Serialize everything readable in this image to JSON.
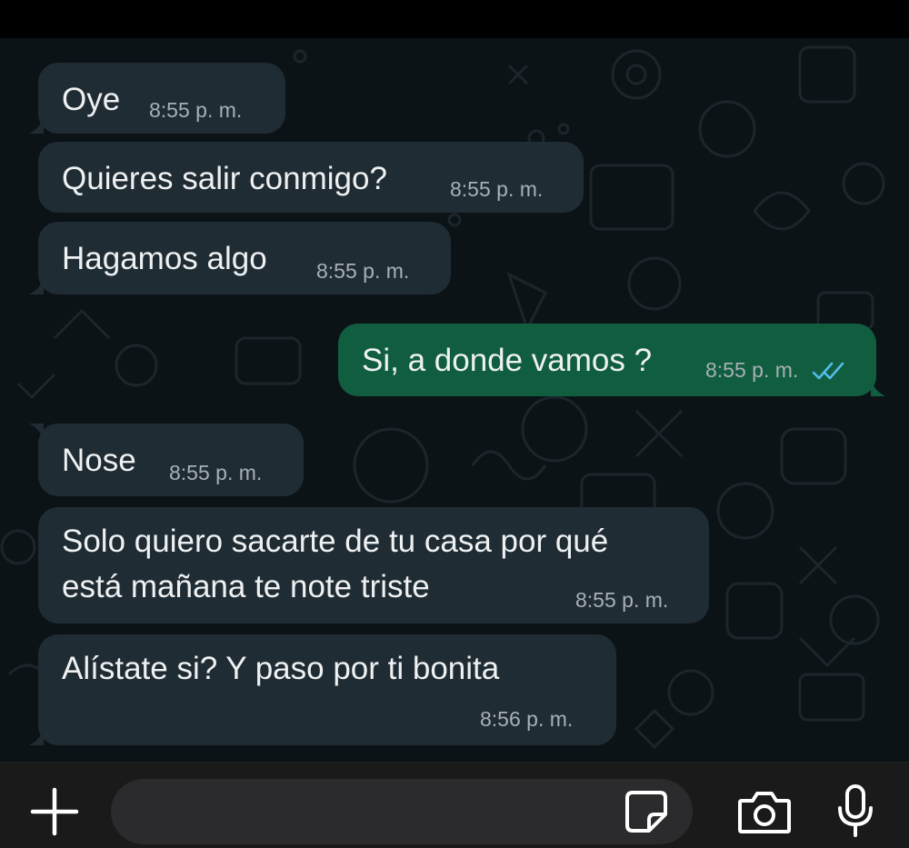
{
  "messages": [
    {
      "direction": "in",
      "text": "Oye",
      "time": "8:55 p. m."
    },
    {
      "direction": "in",
      "text": "Quieres salir conmigo?",
      "time": "8:55 p. m."
    },
    {
      "direction": "in",
      "text": "Hagamos algo",
      "time": "8:55 p. m."
    },
    {
      "direction": "out",
      "text": "Si, a donde vamos ?",
      "time": "8:55 p. m.",
      "status": "read"
    },
    {
      "direction": "in",
      "text": "Nose",
      "time": "8:55 p. m."
    },
    {
      "direction": "in",
      "text_line1": "Solo quiero sacarte de tu casa por qué",
      "text_line2": "está mañana te note triste",
      "time": "8:55 p. m."
    },
    {
      "direction": "in",
      "text": "Alístate si? Y paso por ti bonita",
      "time": "8:56 p. m."
    }
  ],
  "input_bar": {
    "icons": [
      "plus-icon",
      "sticker-icon",
      "camera-icon",
      "microphone-icon"
    ]
  },
  "colors": {
    "incoming_bubble": "#202c33",
    "outgoing_bubble": "#115d40",
    "read_ticks": "#53bdeb",
    "background": "#0b1317"
  }
}
